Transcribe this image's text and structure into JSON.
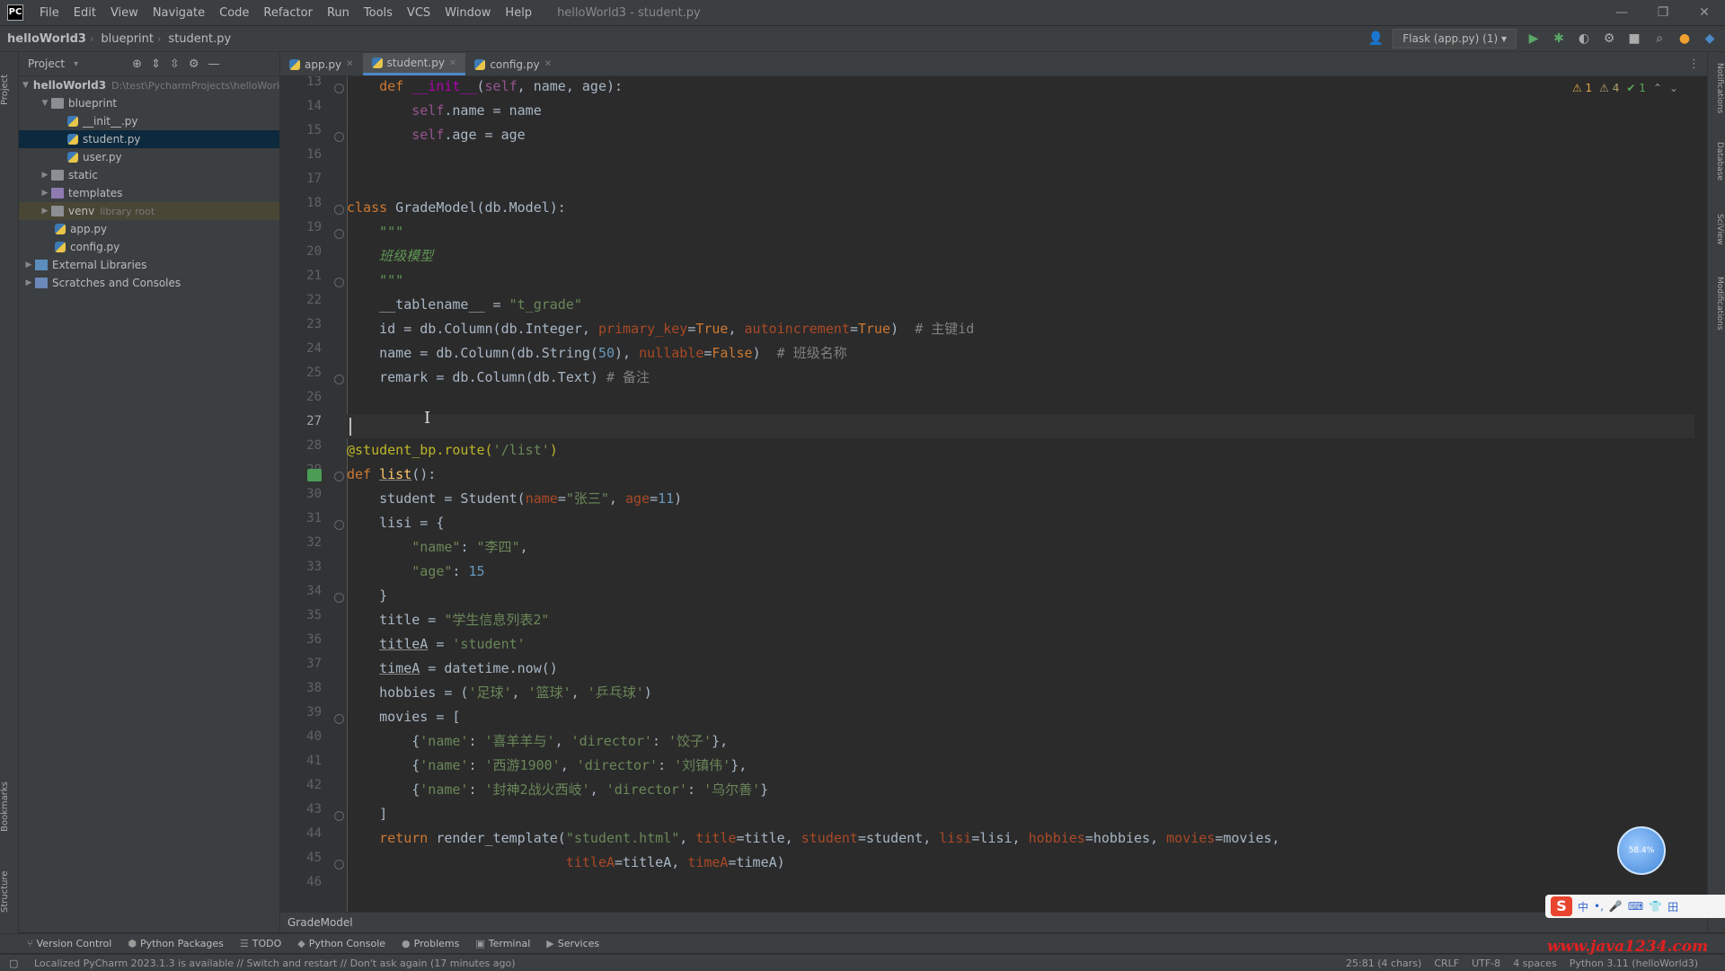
{
  "menubar": {
    "items": [
      "File",
      "Edit",
      "View",
      "Navigate",
      "Code",
      "Refactor",
      "Run",
      "Tools",
      "VCS",
      "Window",
      "Help"
    ],
    "window_title": "helloWorld3 - student.py",
    "logo": "PC"
  },
  "navbar": {
    "crumbs": [
      "helloWorld3",
      "blueprint",
      "student.py"
    ],
    "run_config": "Flask (app.py) (1)"
  },
  "project": {
    "title": "Project",
    "tree": [
      {
        "label": "helloWorld3",
        "path": "D:\\test\\PycharmProjects\\helloWorld3"
      },
      {
        "label": "blueprint"
      },
      {
        "label": "__init__.py"
      },
      {
        "label": "student.py"
      },
      {
        "label": "user.py"
      },
      {
        "label": "static"
      },
      {
        "label": "templates"
      },
      {
        "label": "venv",
        "path": "library root"
      },
      {
        "label": "app.py"
      },
      {
        "label": "config.py"
      },
      {
        "label": "External Libraries"
      },
      {
        "label": "Scratches and Consoles"
      }
    ]
  },
  "tabs": [
    {
      "label": "app.py"
    },
    {
      "label": "student.py"
    },
    {
      "label": "config.py"
    }
  ],
  "editor": {
    "line_numbers": [
      "13",
      "14",
      "15",
      "16",
      "17",
      "18",
      "19",
      "20",
      "21",
      "22",
      "23",
      "24",
      "25",
      "26",
      "27",
      "28",
      "29",
      "30",
      "31",
      "32",
      "33",
      "34",
      "35",
      "36",
      "37",
      "38",
      "39",
      "40",
      "41",
      "42",
      "43",
      "44",
      "45",
      "46"
    ],
    "inspections": {
      "warnings": "1",
      "weak": "4",
      "ok": "1"
    },
    "breadcrumb": "GradeModel"
  },
  "code": {
    "l13": {
      "indent": "    ",
      "def": "def",
      "name": "__init__",
      "open": "(",
      "self": "self",
      ", name, age):": ", name, age):"
    },
    "l14": {
      "indent": "        ",
      "self": "self",
      ".name = name": ".name = name"
    },
    "l15": {
      "indent": "        ",
      "self": "self",
      ".age = age": ".age = age"
    },
    "l18": {
      "kw": "class",
      "rest": " GradeModel(db.Model):"
    },
    "l19": {
      "text": "    \"\"\""
    },
    "l20": {
      "text": "    班级模型"
    },
    "l21": {
      "text": "    \"\"\""
    },
    "l22": {
      "a": "    __tablename__ = ",
      "s": "\"t_grade\""
    },
    "l23": {
      "a": "    id = db.Column(db.Integer, ",
      "p1": "primary_key",
      "e1": "=",
      "k1": "True",
      ", ": ", ",
      "p2": "autoincrement",
      "e2": "=",
      "k2": "True",
      ")": ")  ",
      "c": "# 主键id"
    },
    "l24": {
      "a": "    name = db.Column(db.String(",
      "n": "50",
      "b": "), ",
      "p": "nullable",
      "e": "=",
      "k": "False",
      ")": ")  ",
      "c": "# 班级名称"
    },
    "l25": {
      "a": "    remark = db.Column(db.Text) ",
      "c": "# 备注"
    },
    "l28": {
      "dec": "@student_bp.route(",
      "s": "'/list'",
      ")": ")"
    },
    "l29": {
      "def": "def",
      "sp": " ",
      "name": "list",
      "rest": "():"
    },
    "l30": {
      "a": "    student = Student(",
      "p1": "name",
      "e1": "=",
      "s1": "\"张三\"",
      ", ": ", ",
      "p2": "age",
      "e2": "=",
      "n": "11",
      ")": ")"
    },
    "l31": {
      "text": "    lisi = {"
    },
    "l32": {
      "indent": "        ",
      "s1": "\"name\"",
      ": ": ": ",
      "s2": "\"李四\"",
      ",": ","
    },
    "l33": {
      "indent": "        ",
      "s1": "\"age\"",
      ": ": ": ",
      "n": "15"
    },
    "l34": {
      "text": "    }"
    },
    "l35": {
      "a": "    title = ",
      "s": "\"学生信息列表2\""
    },
    "l36": {
      "indent": "    ",
      "v": "titleA",
      " = ": " = ",
      "s": "'student'"
    },
    "l37": {
      "indent": "    ",
      "v": "timeA",
      "rest": " = datetime.now()"
    },
    "l38": {
      "a": "    hobbies = (",
      "s1": "'足球'",
      ", ": ", ",
      "s2": "'篮球'",
      ",  ": ", ",
      "s3": "'乒乓球'",
      ")": ")"
    },
    "l39": {
      "text": "    movies = ["
    },
    "l40": {
      "a": "        {",
      "s1": "'name'",
      ": ": ": ",
      "s2": "'喜羊羊与'",
      ", ": ", ",
      "s3": "'director'",
      ": 2": ": ",
      "s4": "'饺子'",
      "}": "},"
    },
    "l41": {
      "a": "        {",
      "s1": "'name'",
      ": ": ": ",
      "s2": "'西游1900'",
      ", ": ", ",
      "s3": "'director'",
      ": 2": ": ",
      "s4": "'刘镇伟'",
      "}": "},"
    },
    "l42": {
      "a": "        {",
      "s1": "'name'",
      ": ": ": ",
      "s2": "'封神2战火西岐'",
      ", ": ", ",
      "s3": "'director'",
      ": 2": ": ",
      "s4": "'乌尔善'",
      "}": "}"
    },
    "l43": {
      "text": "    ]"
    },
    "l44": {
      "ret": "    return",
      "a": " render_template(",
      "s": "\"student.html\"",
      ", ": ", ",
      "p1": "title",
      "b1": "=title, ",
      "p2": "student",
      "b2": "=student, ",
      "p3": "lisi",
      "b3": "=lisi, ",
      "p4": "hobbies",
      "b4": "=hobbies, ",
      "p5": "movies",
      "b5": "=movies,"
    },
    "l45": {
      "indent": "                           ",
      "p1": "titleA",
      "b1": "=titleA, ",
      "p2": "timeA",
      "b2": "=timeA)"
    }
  },
  "bottom_tools": [
    "Version Control",
    "Python Packages",
    "TODO",
    "Python Console",
    "Problems",
    "Terminal",
    "Services"
  ],
  "statusbar": {
    "message": "Localized PyCharm 2023.1.3 is available // Switch and restart // Don't ask again (17 minutes ago)",
    "position": "25:81 (4 chars)",
    "line_sep": "CRLF",
    "encoding": "UTF-8",
    "indent": "4 spaces",
    "interpreter": "Python 3.11 (helloWorld3)"
  },
  "overlays": {
    "bubble_text": "58.4%",
    "ime": [
      "中",
      "•,",
      "🎤",
      "⌨",
      "👕",
      "田"
    ],
    "watermark": "www.java1234.com"
  }
}
